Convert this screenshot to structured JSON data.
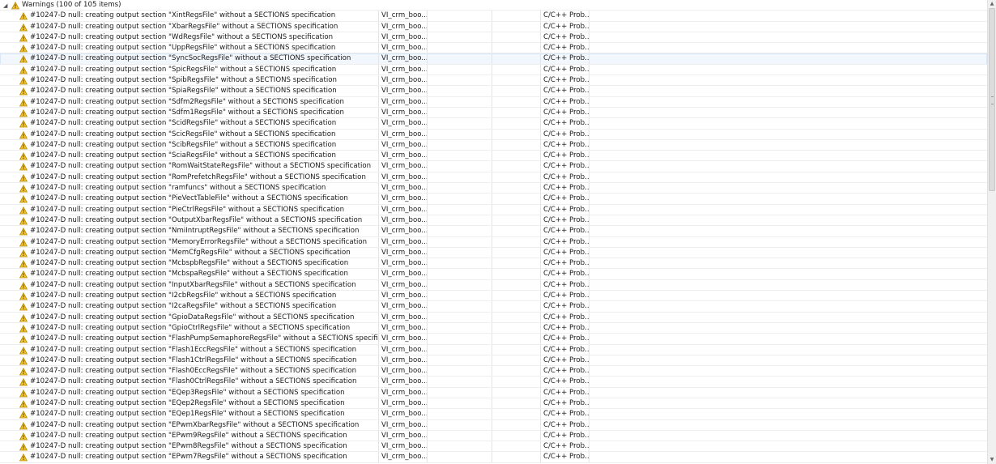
{
  "group": {
    "label": "Warnings (100 of 105 items)"
  },
  "selected_index": 4,
  "rows": [
    {
      "description": "#10247-D null: creating output section \"XintRegsFile\" without a SECTIONS specification",
      "resource": "VI_crm_boo...",
      "type": "C/C++ Prob..."
    },
    {
      "description": "#10247-D null: creating output section \"XbarRegsFile\" without a SECTIONS specification",
      "resource": "VI_crm_boo...",
      "type": "C/C++ Prob..."
    },
    {
      "description": "#10247-D null: creating output section \"WdRegsFile\" without a SECTIONS specification",
      "resource": "VI_crm_boo...",
      "type": "C/C++ Prob..."
    },
    {
      "description": "#10247-D null: creating output section \"UppRegsFile\" without a SECTIONS specification",
      "resource": "VI_crm_boo...",
      "type": "C/C++ Prob..."
    },
    {
      "description": "#10247-D null: creating output section \"SyncSocRegsFile\" without a SECTIONS specification",
      "resource": "VI_crm_boo...",
      "type": "C/C++ Prob..."
    },
    {
      "description": "#10247-D null: creating output section \"SpicRegsFile\" without a SECTIONS specification",
      "resource": "VI_crm_boo...",
      "type": "C/C++ Prob..."
    },
    {
      "description": "#10247-D null: creating output section \"SpibRegsFile\" without a SECTIONS specification",
      "resource": "VI_crm_boo...",
      "type": "C/C++ Prob..."
    },
    {
      "description": "#10247-D null: creating output section \"SpiaRegsFile\" without a SECTIONS specification",
      "resource": "VI_crm_boo...",
      "type": "C/C++ Prob..."
    },
    {
      "description": "#10247-D null: creating output section \"Sdfm2RegsFile\" without a SECTIONS specification",
      "resource": "VI_crm_boo...",
      "type": "C/C++ Prob..."
    },
    {
      "description": "#10247-D null: creating output section \"Sdfm1RegsFile\" without a SECTIONS specification",
      "resource": "VI_crm_boo...",
      "type": "C/C++ Prob..."
    },
    {
      "description": "#10247-D null: creating output section \"ScidRegsFile\" without a SECTIONS specification",
      "resource": "VI_crm_boo...",
      "type": "C/C++ Prob..."
    },
    {
      "description": "#10247-D null: creating output section \"ScicRegsFile\" without a SECTIONS specification",
      "resource": "VI_crm_boo...",
      "type": "C/C++ Prob..."
    },
    {
      "description": "#10247-D null: creating output section \"ScibRegsFile\" without a SECTIONS specification",
      "resource": "VI_crm_boo...",
      "type": "C/C++ Prob..."
    },
    {
      "description": "#10247-D null: creating output section \"SciaRegsFile\" without a SECTIONS specification",
      "resource": "VI_crm_boo...",
      "type": "C/C++ Prob..."
    },
    {
      "description": "#10247-D null: creating output section \"RomWaitStateRegsFile\" without a SECTIONS specification",
      "resource": "VI_crm_boo...",
      "type": "C/C++ Prob..."
    },
    {
      "description": "#10247-D null: creating output section \"RomPrefetchRegsFile\" without a SECTIONS specification",
      "resource": "VI_crm_boo...",
      "type": "C/C++ Prob..."
    },
    {
      "description": "#10247-D null: creating output section \"ramfuncs\" without a SECTIONS specification",
      "resource": "VI_crm_boo...",
      "type": "C/C++ Prob..."
    },
    {
      "description": "#10247-D null: creating output section \"PieVectTableFile\" without a SECTIONS specification",
      "resource": "VI_crm_boo...",
      "type": "C/C++ Prob..."
    },
    {
      "description": "#10247-D null: creating output section \"PieCtrlRegsFile\" without a SECTIONS specification",
      "resource": "VI_crm_boo...",
      "type": "C/C++ Prob..."
    },
    {
      "description": "#10247-D null: creating output section \"OutputXbarRegsFile\" without a SECTIONS specification",
      "resource": "VI_crm_boo...",
      "type": "C/C++ Prob..."
    },
    {
      "description": "#10247-D null: creating output section \"NmiIntruptRegsFile\" without a SECTIONS specification",
      "resource": "VI_crm_boo...",
      "type": "C/C++ Prob..."
    },
    {
      "description": "#10247-D null: creating output section \"MemoryErrorRegsFile\" without a SECTIONS specification",
      "resource": "VI_crm_boo...",
      "type": "C/C++ Prob..."
    },
    {
      "description": "#10247-D null: creating output section \"MemCfgRegsFile\" without a SECTIONS specification",
      "resource": "VI_crm_boo...",
      "type": "C/C++ Prob..."
    },
    {
      "description": "#10247-D null: creating output section \"McbspbRegsFile\" without a SECTIONS specification",
      "resource": "VI_crm_boo...",
      "type": "C/C++ Prob..."
    },
    {
      "description": "#10247-D null: creating output section \"McbspaRegsFile\" without a SECTIONS specification",
      "resource": "VI_crm_boo...",
      "type": "C/C++ Prob..."
    },
    {
      "description": "#10247-D null: creating output section \"InputXbarRegsFile\" without a SECTIONS specification",
      "resource": "VI_crm_boo...",
      "type": "C/C++ Prob..."
    },
    {
      "description": "#10247-D null: creating output section \"I2cbRegsFile\" without a SECTIONS specification",
      "resource": "VI_crm_boo...",
      "type": "C/C++ Prob..."
    },
    {
      "description": "#10247-D null: creating output section \"I2caRegsFile\" without a SECTIONS specification",
      "resource": "VI_crm_boo...",
      "type": "C/C++ Prob..."
    },
    {
      "description": "#10247-D null: creating output section \"GpioDataRegsFile\" without a SECTIONS specification",
      "resource": "VI_crm_boo...",
      "type": "C/C++ Prob..."
    },
    {
      "description": "#10247-D null: creating output section \"GpioCtrlRegsFile\" without a SECTIONS specification",
      "resource": "VI_crm_boo...",
      "type": "C/C++ Prob..."
    },
    {
      "description": "#10247-D null: creating output section \"FlashPumpSemaphoreRegsFile\" without a SECTIONS specification",
      "resource": "VI_crm_boo...",
      "type": "C/C++ Prob..."
    },
    {
      "description": "#10247-D null: creating output section \"Flash1EccRegsFile\" without a SECTIONS specification",
      "resource": "VI_crm_boo...",
      "type": "C/C++ Prob..."
    },
    {
      "description": "#10247-D null: creating output section \"Flash1CtrlRegsFile\" without a SECTIONS specification",
      "resource": "VI_crm_boo...",
      "type": "C/C++ Prob..."
    },
    {
      "description": "#10247-D null: creating output section \"Flash0EccRegsFile\" without a SECTIONS specification",
      "resource": "VI_crm_boo...",
      "type": "C/C++ Prob..."
    },
    {
      "description": "#10247-D null: creating output section \"Flash0CtrlRegsFile\" without a SECTIONS specification",
      "resource": "VI_crm_boo...",
      "type": "C/C++ Prob..."
    },
    {
      "description": "#10247-D null: creating output section \"EQep3RegsFile\" without a SECTIONS specification",
      "resource": "VI_crm_boo...",
      "type": "C/C++ Prob..."
    },
    {
      "description": "#10247-D null: creating output section \"EQep2RegsFile\" without a SECTIONS specification",
      "resource": "VI_crm_boo...",
      "type": "C/C++ Prob..."
    },
    {
      "description": "#10247-D null: creating output section \"EQep1RegsFile\" without a SECTIONS specification",
      "resource": "VI_crm_boo...",
      "type": "C/C++ Prob..."
    },
    {
      "description": "#10247-D null: creating output section \"EPwmXbarRegsFile\" without a SECTIONS specification",
      "resource": "VI_crm_boo...",
      "type": "C/C++ Prob..."
    },
    {
      "description": "#10247-D null: creating output section \"EPwm9RegsFile\" without a SECTIONS specification",
      "resource": "VI_crm_boo...",
      "type": "C/C++ Prob..."
    },
    {
      "description": "#10247-D null: creating output section \"EPwm8RegsFile\" without a SECTIONS specification",
      "resource": "VI_crm_boo...",
      "type": "C/C++ Prob..."
    },
    {
      "description": "#10247-D null: creating output section \"EPwm7RegsFile\" without a SECTIONS specification",
      "resource": "VI_crm_boo...",
      "type": "C/C++ Prob..."
    }
  ]
}
